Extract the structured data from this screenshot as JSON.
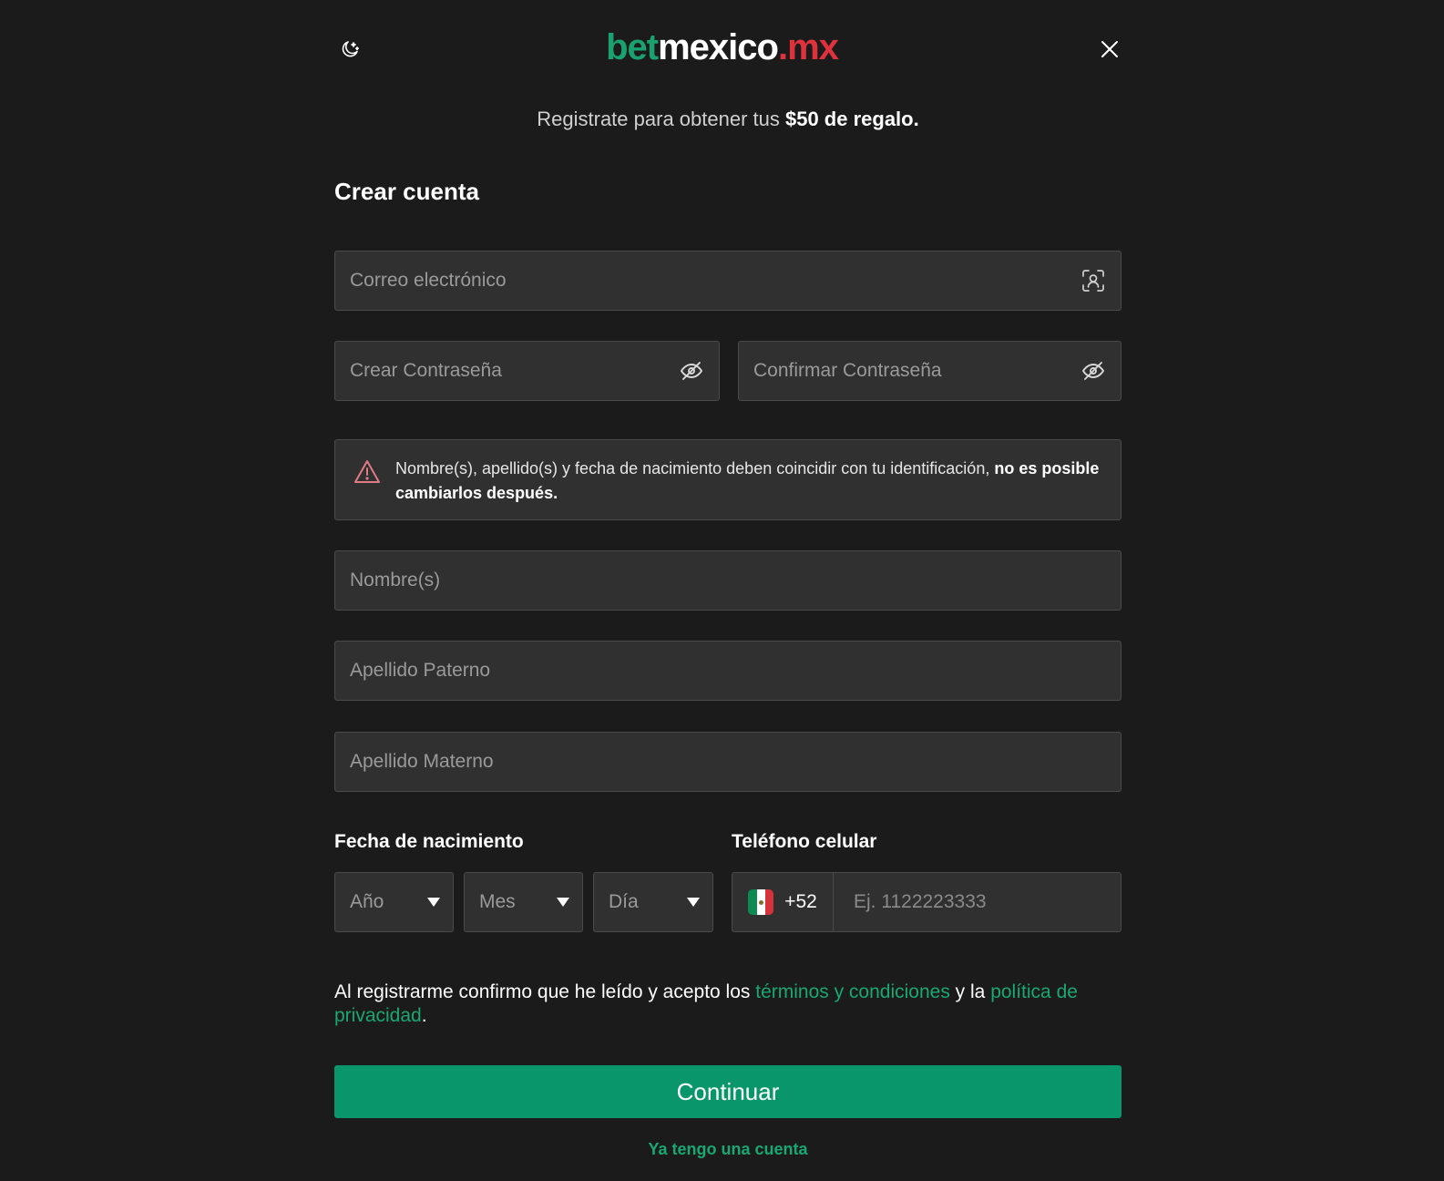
{
  "header": {
    "logo": {
      "part1": "bet",
      "part2": "mexico",
      "part3": ".mx"
    },
    "theme_icon": "moon-stars-icon",
    "close_icon": "close-icon"
  },
  "promo": {
    "text": "Registrate para obtener tus ",
    "highlight": "$50 de regalo."
  },
  "form": {
    "title": "Crear cuenta",
    "email_placeholder": "Correo electrónico",
    "password_placeholder": "Crear Contraseña",
    "confirm_password_placeholder": "Confirmar Contraseña",
    "notice_text": "Nombre(s), apellido(s) y fecha de nacimiento deben coincidir con tu identificación, ",
    "notice_bold": "no es posible cambiarlos después.",
    "first_name_placeholder": "Nombre(s)",
    "paternal_surname_placeholder": "Apellido Paterno",
    "maternal_surname_placeholder": "Apellido Materno",
    "birthdate_label": "Fecha de nacimiento",
    "year_label": "Año",
    "month_label": "Mes",
    "day_label": "Día",
    "phone_label": "Teléfono celular",
    "phone_prefix": "+52",
    "phone_placeholder": "Ej. 1122223333"
  },
  "terms": {
    "prefix": "Al registrarme confirmo que he leído y acepto los ",
    "terms_link": "términos y condiciones",
    "middle": " y la ",
    "privacy_link": "política de privacidad",
    "suffix": "."
  },
  "actions": {
    "continue_label": "Continuar",
    "login_link": "Ya tengo una cuenta"
  },
  "colors": {
    "background": "#1b1b1b",
    "field": "#303030",
    "accent_green": "#08966a",
    "link_green": "#19a872",
    "brand_red": "#e0323c"
  }
}
